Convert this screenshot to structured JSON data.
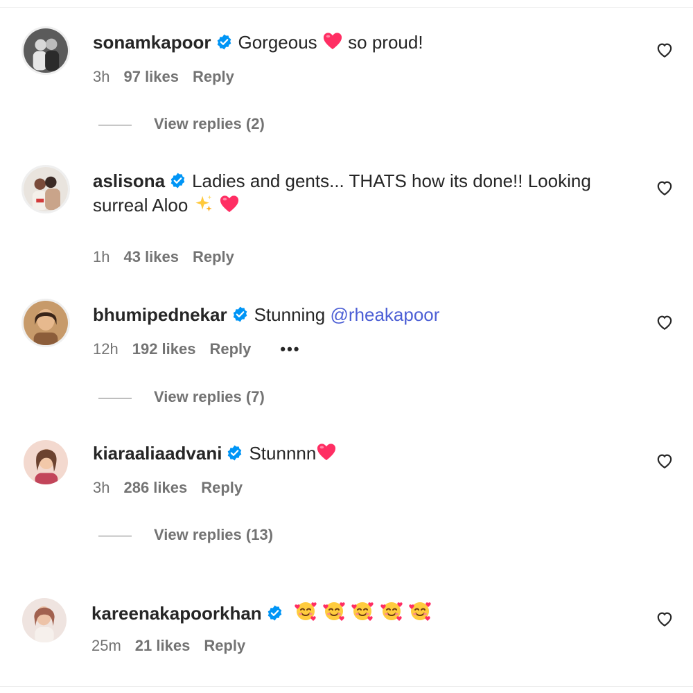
{
  "comments": [
    {
      "username": "sonamkapoor",
      "text": "Gorgeous",
      "text_after_emoji": "so proud!",
      "time": "3h",
      "likes": "97 likes",
      "reply": "Reply",
      "view_replies": "View replies (2)"
    },
    {
      "username": "aslisona",
      "text_line1": "Ladies and gents... THATS how its done!! Looking",
      "text_line2": "surreal Aloo",
      "time": "1h",
      "likes": "43 likes",
      "reply": "Reply"
    },
    {
      "username": "bhumipednekar",
      "text": "Stunning",
      "mention": "@rheakapoor",
      "time": "12h",
      "likes": "192 likes",
      "reply": "Reply",
      "more": "•••",
      "view_replies": "View replies (7)"
    },
    {
      "username": "kiaraaliaadvani",
      "text": "Stunnnn",
      "time": "3h",
      "likes": "286 likes",
      "reply": "Reply",
      "view_replies": "View replies (13)"
    },
    {
      "username": "kareenakapoorkhan",
      "time": "25m",
      "likes": "21 likes",
      "reply": "Reply"
    }
  ],
  "icons": {
    "verified": "verified-badge-icon",
    "like": "heart-outline-icon",
    "accent": "#0095f6",
    "heart_emoji_color": "#ff2e63"
  }
}
